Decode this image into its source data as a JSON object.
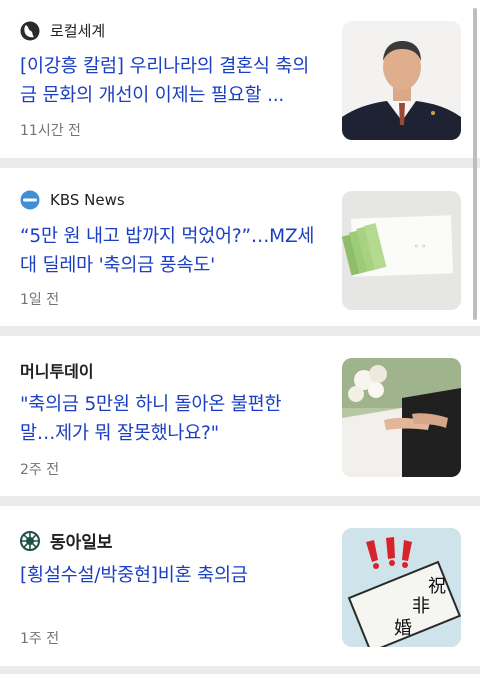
{
  "articles": [
    {
      "source": "로컬세계",
      "headline": "[이강흥 칼럼] 우리나라의 결혼식 축의금 문화의 개선이 이제는 필요할 ...",
      "time": "11시간 전"
    },
    {
      "source": "KBS News",
      "headline": "“5만 원 내고 밥까지 먹었어?”…MZ세대 딜레마 '축의금 풍속도'",
      "time": "1일 전"
    },
    {
      "source": "머니투데이",
      "headline": "\"축의금 5만원 하니 돌아온 불편한 말…제가 뭐 잘못했나요?\"",
      "time": "2주 전"
    },
    {
      "source": "동아일보",
      "headline": "[횡설수설/박중현]비혼 축의금",
      "time": "1주 전",
      "thumb_text": [
        "祝",
        "非",
        "婚"
      ]
    }
  ],
  "colors": {
    "headline": "#1a3fc3",
    "meta": "#70757a",
    "background": "#ebebeb"
  }
}
